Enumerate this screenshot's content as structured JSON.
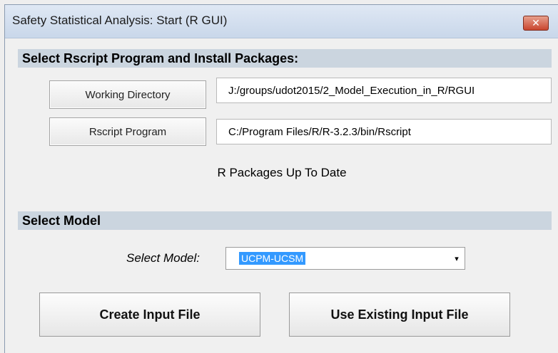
{
  "window": {
    "title": "Safety Statistical Analysis: Start (R GUI)",
    "close_glyph": "✕"
  },
  "section1": {
    "heading": "Select Rscript Program and Install Packages:",
    "working_dir_button": "Working Directory",
    "working_dir_value": "J:/groups/udot2015/2_Model_Execution_in_R/RGUI",
    "rscript_button": "Rscript Program",
    "rscript_value": "C:/Program Files/R/R-3.2.3/bin/Rscript",
    "packages_status": "R Packages Up To Date"
  },
  "section2": {
    "heading": "Select Model",
    "model_label": "Select Model:",
    "model_selected": "UCPM-UCSM",
    "dropdown_glyph": "▾"
  },
  "actions": {
    "create_input": "Create Input File",
    "use_existing": "Use Existing Input File"
  },
  "colors": {
    "section_bar": "#cbd5df",
    "selection": "#3399ff",
    "close_button": "#c9462f"
  }
}
